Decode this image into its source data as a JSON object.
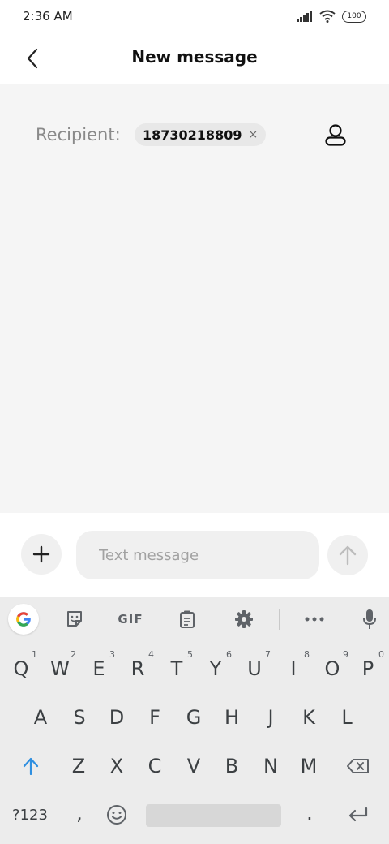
{
  "status": {
    "time": "2:36 AM",
    "battery": "100"
  },
  "header": {
    "title": "New message",
    "back_icon": "chevron-left-icon"
  },
  "recipient": {
    "label": "Recipient:",
    "number": "18730218809",
    "remove": "×",
    "contact_icon": "contact-icon"
  },
  "compose": {
    "placeholder": "Text message",
    "value": "",
    "add_icon": "plus-icon",
    "send_icon": "arrow-up-icon"
  },
  "keyboard": {
    "toolbar": {
      "gif": "GIF"
    },
    "row1": [
      {
        "k": "Q",
        "h": "1"
      },
      {
        "k": "W",
        "h": "2"
      },
      {
        "k": "E",
        "h": "3"
      },
      {
        "k": "R",
        "h": "4"
      },
      {
        "k": "T",
        "h": "5"
      },
      {
        "k": "Y",
        "h": "6"
      },
      {
        "k": "U",
        "h": "7"
      },
      {
        "k": "I",
        "h": "8"
      },
      {
        "k": "O",
        "h": "9"
      },
      {
        "k": "P",
        "h": "0"
      }
    ],
    "row2": [
      "A",
      "S",
      "D",
      "F",
      "G",
      "H",
      "J",
      "K",
      "L"
    ],
    "row3": [
      "Z",
      "X",
      "C",
      "V",
      "B",
      "N",
      "M"
    ],
    "bottom": {
      "symbols": "?123",
      "comma": ",",
      "period": "."
    }
  },
  "colors": {
    "accent": "#2f8fe0",
    "surface": "#f5f5f5",
    "keyboard_bg": "#ececec"
  }
}
